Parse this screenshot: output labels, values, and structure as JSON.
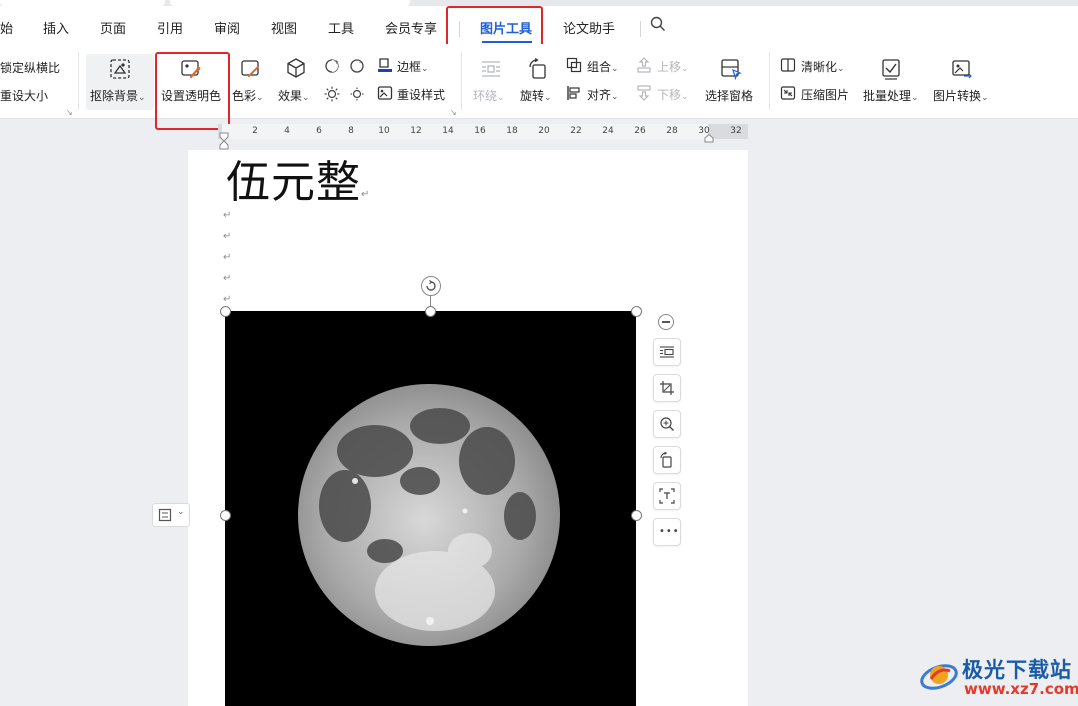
{
  "menu": {
    "items": [
      {
        "label": "始"
      },
      {
        "label": "插入"
      },
      {
        "label": "页面"
      },
      {
        "label": "引用"
      },
      {
        "label": "审阅"
      },
      {
        "label": "视图"
      },
      {
        "label": "工具"
      },
      {
        "label": "会员专享"
      },
      {
        "label": "图片工具",
        "active": true
      },
      {
        "label": "论文助手"
      }
    ],
    "search_icon": "search-icon"
  },
  "ribbon": {
    "lock_ratio": "锁定纵横比",
    "reset_size": "重设大小",
    "remove_bg": "抠除背景",
    "set_transparent": "设置透明色",
    "color": "色彩",
    "effects": "效果",
    "border": "边框",
    "reset_style": "重设样式",
    "wrap": "环绕",
    "rotate": "旋转",
    "group": "组合",
    "align": "对齐",
    "bring_forward": "上移",
    "send_backward": "下移",
    "selection_pane": "选择窗格",
    "sharpen": "清晰化",
    "compress": "压缩图片",
    "batch": "批量处理",
    "convert": "图片转换"
  },
  "ruler": {
    "ticks": [
      "2",
      "4",
      "6",
      "8",
      "10",
      "12",
      "14",
      "16",
      "18",
      "20",
      "22",
      "24",
      "26",
      "28",
      "30",
      "32"
    ]
  },
  "document": {
    "heading": "伍元整",
    "paragraph_mark": "↵"
  },
  "watermark": {
    "name": "极光下载站",
    "url": "www.xz7.com"
  },
  "colors": {
    "accent": "#1e5fd8",
    "highlight": "#e0262b",
    "border_icon": "#1f3fbf"
  }
}
